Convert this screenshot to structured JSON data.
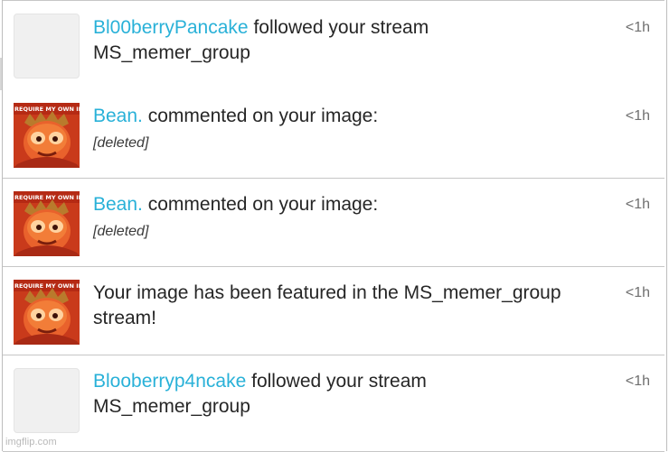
{
  "notifications": [
    {
      "type": "follow",
      "username": "Bl00berryPancake",
      "action": "followed your stream",
      "detail": "MS_memer_group",
      "time": "<1h",
      "avatar": "placeholder"
    },
    {
      "type": "comment",
      "username": "Bean.",
      "action": "commented on your image:",
      "detail": "[deleted]",
      "time": "<1h",
      "avatar": "image-thumbnail"
    },
    {
      "type": "comment",
      "username": "Bean.",
      "action": "commented on your image:",
      "detail": "[deleted]",
      "time": "<1h",
      "avatar": "image-thumbnail"
    },
    {
      "type": "featured",
      "message_line1": "Your image has been featured in the MS_memer_group",
      "message_line2": "stream!",
      "time": "<1h",
      "avatar": "image-thumbnail"
    },
    {
      "type": "follow",
      "username": "Blooberryp4ncake",
      "action": "followed your stream",
      "detail": "MS_memer_group",
      "time": "<1h",
      "avatar": "placeholder"
    }
  ],
  "thumbnail_caption": "REQUIRE MY OWN IMPOSTE",
  "watermark": "imgflip.com",
  "colors": {
    "username": "#29b1d8",
    "text": "#262626",
    "time": "#6f6f6f",
    "divider": "#c6c6c6"
  }
}
